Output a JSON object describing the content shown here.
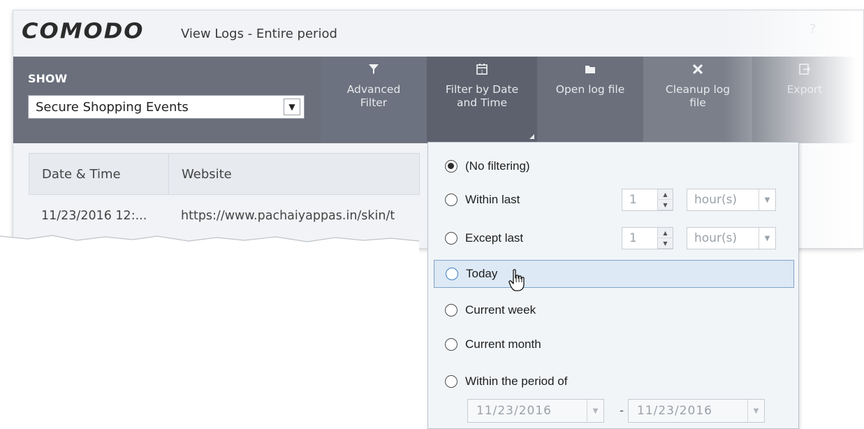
{
  "window": {
    "logo": "COMODO",
    "title": "View Logs - Entire period",
    "help": "?"
  },
  "toolbar": {
    "show_label": "SHOW",
    "show_value": "Secure Shopping Events",
    "buttons": [
      {
        "label": "Advanced\nFilter",
        "icon": "filter-icon"
      },
      {
        "label": "Filter by Date\nand Time",
        "icon": "calendar-icon"
      },
      {
        "label": "Open log file",
        "icon": "folder-icon"
      },
      {
        "label": "Cleanup log\nfile",
        "icon": "cross-icon"
      },
      {
        "label": "Export",
        "icon": "export-icon"
      }
    ]
  },
  "table": {
    "columns": [
      "Date & Time",
      "Website"
    ],
    "rows": [
      [
        "11/23/2016 12:...",
        "https://www.pachaiyappas.in/skin/t"
      ]
    ]
  },
  "date_filter": {
    "options": [
      {
        "label": "(No filtering)",
        "checked": true
      },
      {
        "label": "Within last",
        "checked": false
      },
      {
        "label": "Except last",
        "checked": false
      },
      {
        "label": "Today",
        "checked": false,
        "hovered": true
      },
      {
        "label": "Current week",
        "checked": false
      },
      {
        "label": "Current month",
        "checked": false
      },
      {
        "label": "Within the period of",
        "checked": false
      }
    ],
    "within_last": {
      "value": "1",
      "unit": "hour(s)"
    },
    "except_last": {
      "value": "1",
      "unit": "hour(s)"
    },
    "period": {
      "from": "11/23/2016",
      "to": "11/23/2016",
      "separator": "-"
    }
  },
  "colors": {
    "toolbar_bg": "#6a6f7b",
    "toolbar_active": "#5c616d",
    "dropdown_bg": "#f2f5f8",
    "hover_highlight": "#dde9f5"
  }
}
